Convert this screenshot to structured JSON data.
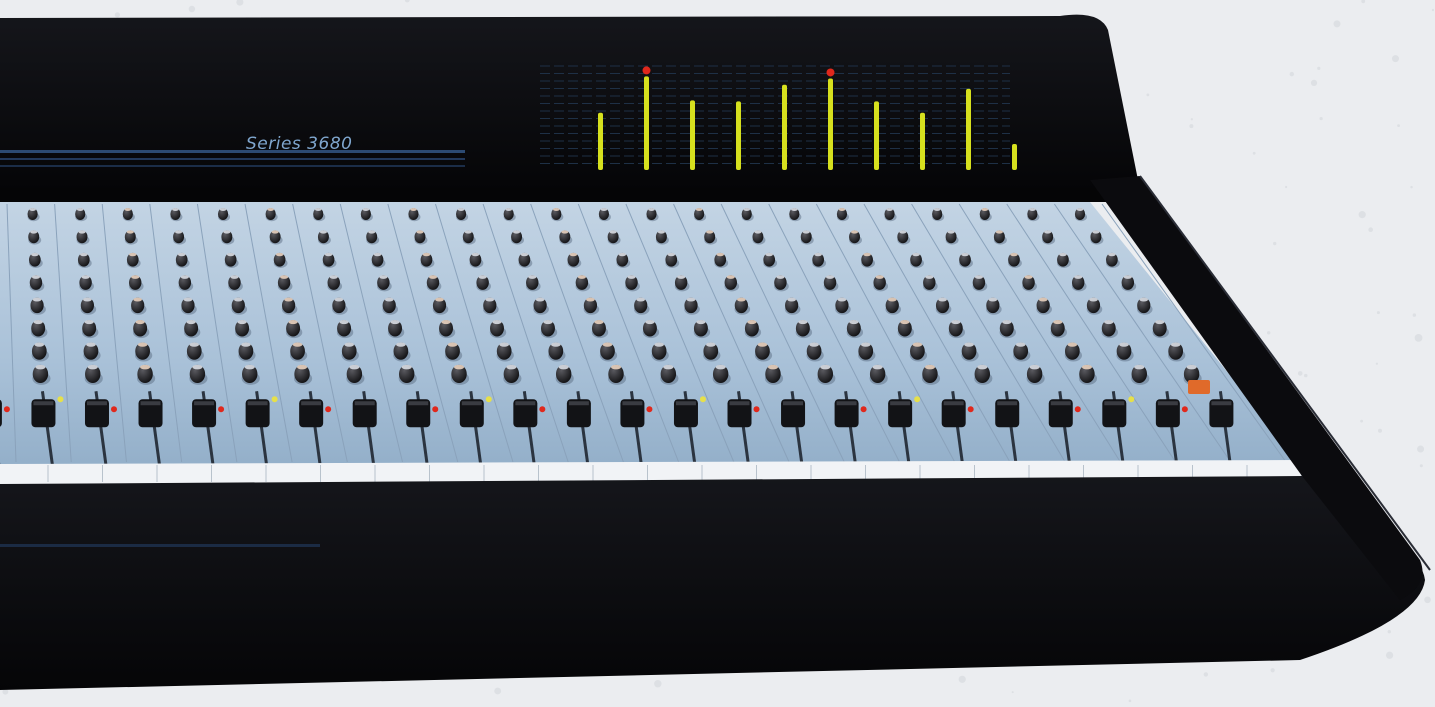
{
  "console": {
    "model_label": "Series 3680"
  },
  "meter_bridge": {
    "levels": [
      0.55,
      0.9,
      0.67,
      0.66,
      0.82,
      0.88,
      0.66,
      0.55,
      0.78,
      0.25
    ],
    "peak_lit": [
      false,
      true,
      false,
      false,
      false,
      true,
      false,
      false,
      false,
      false
    ]
  },
  "colors": {
    "background": "#ebedf0",
    "console_body": "#0a0a0d",
    "panel": "#a9c1d8",
    "meter_led": "#d6e01e",
    "peak_led": "#e0281c",
    "brand_text": "#7fa6ce"
  },
  "icons": {
    "knob": "rotary-knob-icon",
    "fader": "slide-fader-icon",
    "led": "indicator-led-icon"
  }
}
